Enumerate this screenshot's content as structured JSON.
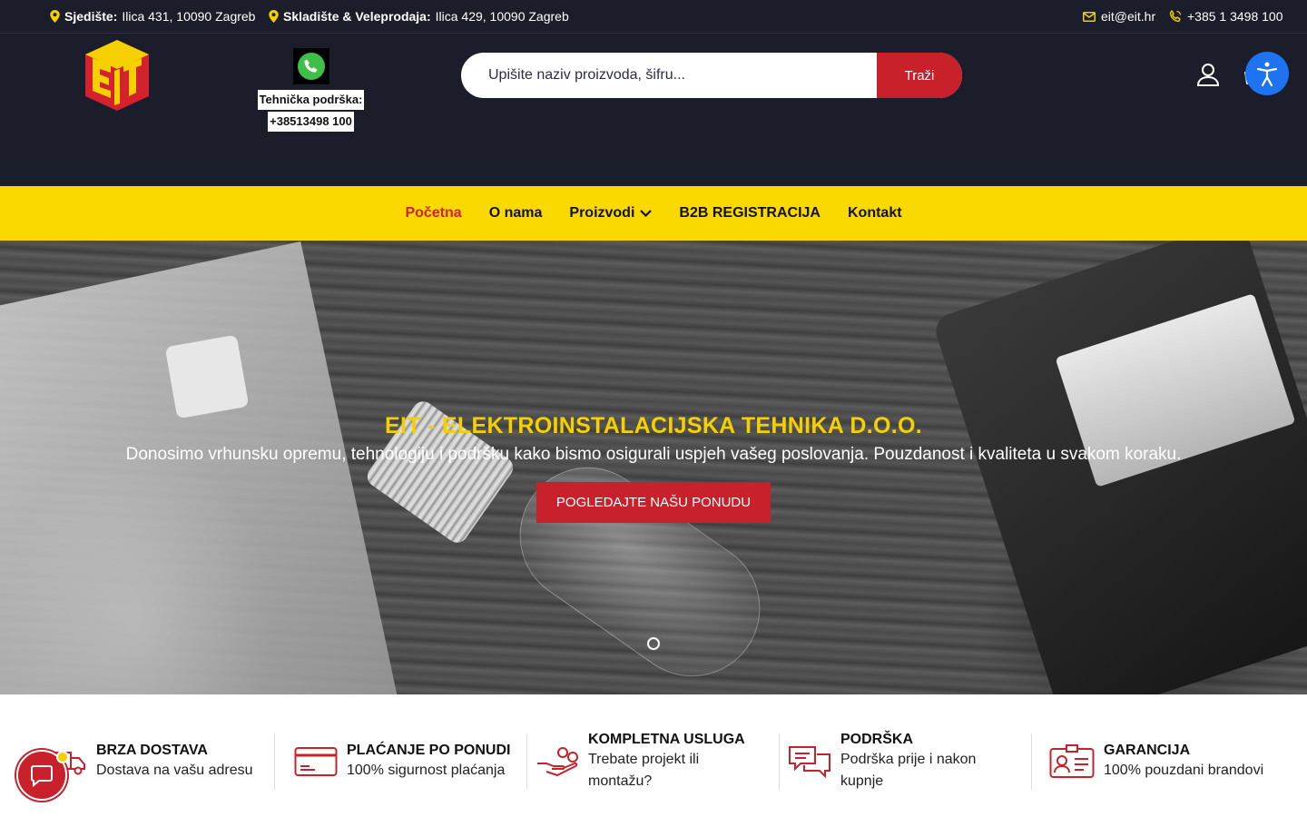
{
  "topbar": {
    "hq_label": "Sjedište:",
    "hq_address": "Ilica 431, 10090 Zagreb",
    "warehouse_label": "Skladište & Veleprodaja:",
    "warehouse_address": "Ilica 429, 10090 Zagreb",
    "email": "eit@eit.hr",
    "phone": "+385 1 3498 100"
  },
  "header": {
    "support_label": "Tehnička podrška:",
    "support_phone": "+38513498 100",
    "search_placeholder": "Upišite naziv proizvoda, šifru...",
    "search_button": "Traži",
    "cart_count": "0"
  },
  "nav": {
    "items": [
      {
        "label": "Početna",
        "active": true
      },
      {
        "label": "O nama",
        "active": false
      },
      {
        "label": "Proizvodi",
        "active": false
      },
      {
        "label": "B2B REGISTRACIJA",
        "active": false
      },
      {
        "label": "Kontakt",
        "active": false
      }
    ]
  },
  "hero": {
    "title": "EIT - ELEKTROINSTALACIJSKA TEHNIKA D.O.O.",
    "subtitle": "Donosimo vrhunsku opremu, tehnologiju i podršku kako bismo osigurali uspjeh vašeg poslovanja. Pouzdanost i kvaliteta u svakom koraku.",
    "cta": "POGLEDAJTE NAŠU PONUDU"
  },
  "features": [
    {
      "icon": "delivery-truck-icon",
      "title": "BRZA DOSTAVA",
      "line1": "Dostava na vašu adresu",
      "line2": ""
    },
    {
      "icon": "credit-card-icon",
      "title": "PLAĆANJE PO PONUDI",
      "line1": "100% sigurnost plaćanja",
      "line2": ""
    },
    {
      "icon": "hand-coins-icon",
      "title": "KOMPLETNA USLUGA",
      "line1": "Trebate projekt ili",
      "line2": "montažu?"
    },
    {
      "icon": "chat-bubbles-icon",
      "title": "PODRŠKA",
      "line1": "Podrška prije i nakon",
      "line2": "kupnje"
    },
    {
      "icon": "id-card-icon",
      "title": "GARANCIJA",
      "line1": "100% pouzdani brandovi",
      "line2": ""
    }
  ],
  "colors": {
    "dark": "#1b1d2b",
    "yellow": "#f9d900",
    "red": "#c8212b",
    "accessibility_blue": "#1e73f0"
  }
}
